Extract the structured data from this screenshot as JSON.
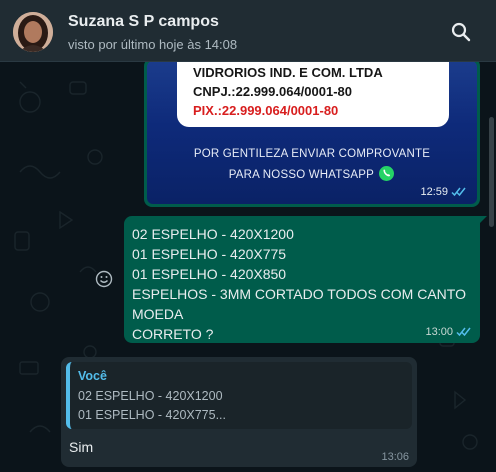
{
  "header": {
    "contact_name": "Suzana S P campos",
    "last_seen": "visto por último hoje às 14:08",
    "search_icon": "search-icon"
  },
  "messages": {
    "image_message": {
      "card_lines": [
        "VIDRORIOS IND. E COM. LTDA",
        "CNPJ.:22.999.064/0001-80",
        "PIX.:22.999.064/0001-80"
      ],
      "caption_lines": [
        "POR GENTILEZA ENVIAR COMPROVANTE",
        "PARA NOSSO WHATSAPP"
      ],
      "time": "12:59",
      "status_icon": "double-check-icon"
    },
    "outgoing_text": {
      "lines": [
        "02 ESPELHO - 420X1200",
        "01 ESPELHO - 420X775",
        "01 ESPELHO - 420X850",
        "ESPELHOS - 3MM CORTADO TODOS COM CANTO",
        "MOEDA",
        "CORRETO ?"
      ],
      "time": "13:00",
      "status_icon": "double-check-icon"
    },
    "incoming_reply": {
      "quote_author": "Você",
      "quote_lines": [
        "02 ESPELHO - 420X1200",
        "01 ESPELHO - 420X775..."
      ],
      "text": "Sim",
      "time": "13:06"
    }
  },
  "colors": {
    "outgoing_bubble": "#005c4b",
    "incoming_bubble": "#202c33",
    "read_receipt": "#53bdeb",
    "background": "#0b141a"
  }
}
